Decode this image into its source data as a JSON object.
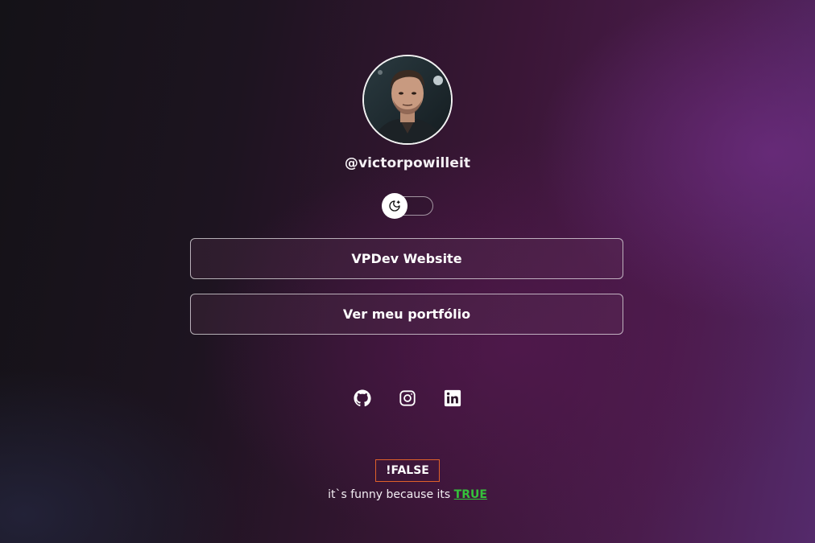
{
  "profile": {
    "username": "@victorpowilleit",
    "avatar_alt": "profile photo"
  },
  "theme_toggle": {
    "icon": "moon-icon",
    "state": "off"
  },
  "links": [
    {
      "label": "VPDev Website"
    },
    {
      "label": "Ver meu portfólio"
    }
  ],
  "socials": [
    {
      "icon": "github-icon"
    },
    {
      "icon": "instagram-icon"
    },
    {
      "icon": "linkedin-icon"
    }
  ],
  "footer": {
    "badge": "!FALSE",
    "joke_prefix": "it`s funny because its ",
    "joke_highlight": "TRUE"
  },
  "colors": {
    "badge_border": "#e0622a",
    "highlight": "#35c23b"
  }
}
